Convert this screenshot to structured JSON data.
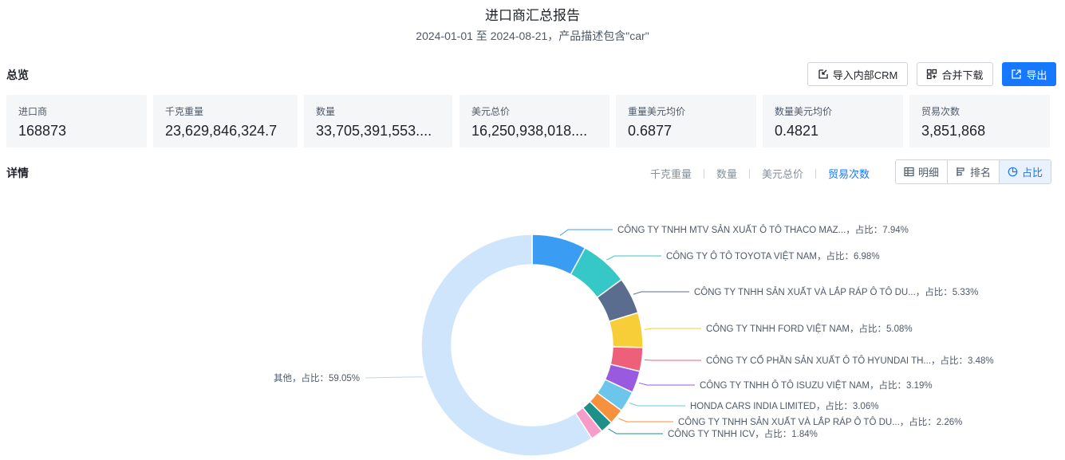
{
  "header": {
    "title": "进口商汇总报告",
    "subtitle": "2024-01-01 至 2024-08-21，产品描述包含\"car\""
  },
  "overview": {
    "label": "总览",
    "actions": {
      "import_crm": "导入内部CRM",
      "merge_download": "合并下载",
      "export": "导出"
    },
    "stats": [
      {
        "label": "进口商",
        "value": "168873"
      },
      {
        "label": "千克重量",
        "value": "23,629,846,324.7"
      },
      {
        "label": "数量",
        "value": "33,705,391,553...."
      },
      {
        "label": "美元总价",
        "value": "16,250,938,018...."
      },
      {
        "label": "重量美元均价",
        "value": "0.6877"
      },
      {
        "label": "数量美元均价",
        "value": "0.4821"
      },
      {
        "label": "贸易次数",
        "value": "3,851,868"
      }
    ]
  },
  "details": {
    "label": "详情",
    "metric_tabs": [
      "千克重量",
      "数量",
      "美元总价",
      "贸易次数"
    ],
    "active_metric": "贸易次数",
    "views": [
      {
        "label": "明细",
        "icon": "table-icon"
      },
      {
        "label": "排名",
        "icon": "ranking-icon"
      },
      {
        "label": "占比",
        "icon": "pie-chart-icon"
      }
    ],
    "active_view": "占比"
  },
  "chart_data": {
    "type": "pie",
    "variant": "donut",
    "label_format": "{name}，占比：{value}%",
    "slices": [
      {
        "name": "CÔNG TY TNHH MTV SẢN XUẤT Ô TÔ THACO MAZ...",
        "value": 7.94,
        "color": "#3b9cf3"
      },
      {
        "name": "CÔNG TY Ô TÔ TOYOTA VIỆT NAM",
        "value": 6.98,
        "color": "#35c8c6"
      },
      {
        "name": "CÔNG TY TNHH SẢN XUẤT VÀ LẮP RÁP Ô TÔ DU...",
        "value": 5.33,
        "color": "#5b6d8f"
      },
      {
        "name": "CÔNG TY TNHH FORD VIỆT NAM",
        "value": 5.08,
        "color": "#f7ce38"
      },
      {
        "name": "CÔNG TY CỔ PHẦN SẢN XUẤT Ô TÔ HYUNDAI TH...",
        "value": 3.48,
        "color": "#ee6079"
      },
      {
        "name": "CÔNG TY TNHH Ô TÔ ISUZU VIỆT NAM",
        "value": 3.19,
        "color": "#9a5ae0"
      },
      {
        "name": "HONDA CARS INDIA LIMITED",
        "value": 3.06,
        "color": "#6cc6ec"
      },
      {
        "name": "CÔNG TY TNHH SẢN XUẤT VÀ LẮP RÁP Ô TÔ DU...",
        "value": 2.26,
        "color": "#f7913d"
      },
      {
        "name": "CÔNG TY TNHH ICV",
        "value": 1.84,
        "color": "#1f8f8a"
      },
      {
        "name": "",
        "value": 1.79,
        "color": "#f59ccb"
      },
      {
        "name": "其他",
        "value": 59.05,
        "color": "#cfe5fb"
      }
    ]
  }
}
